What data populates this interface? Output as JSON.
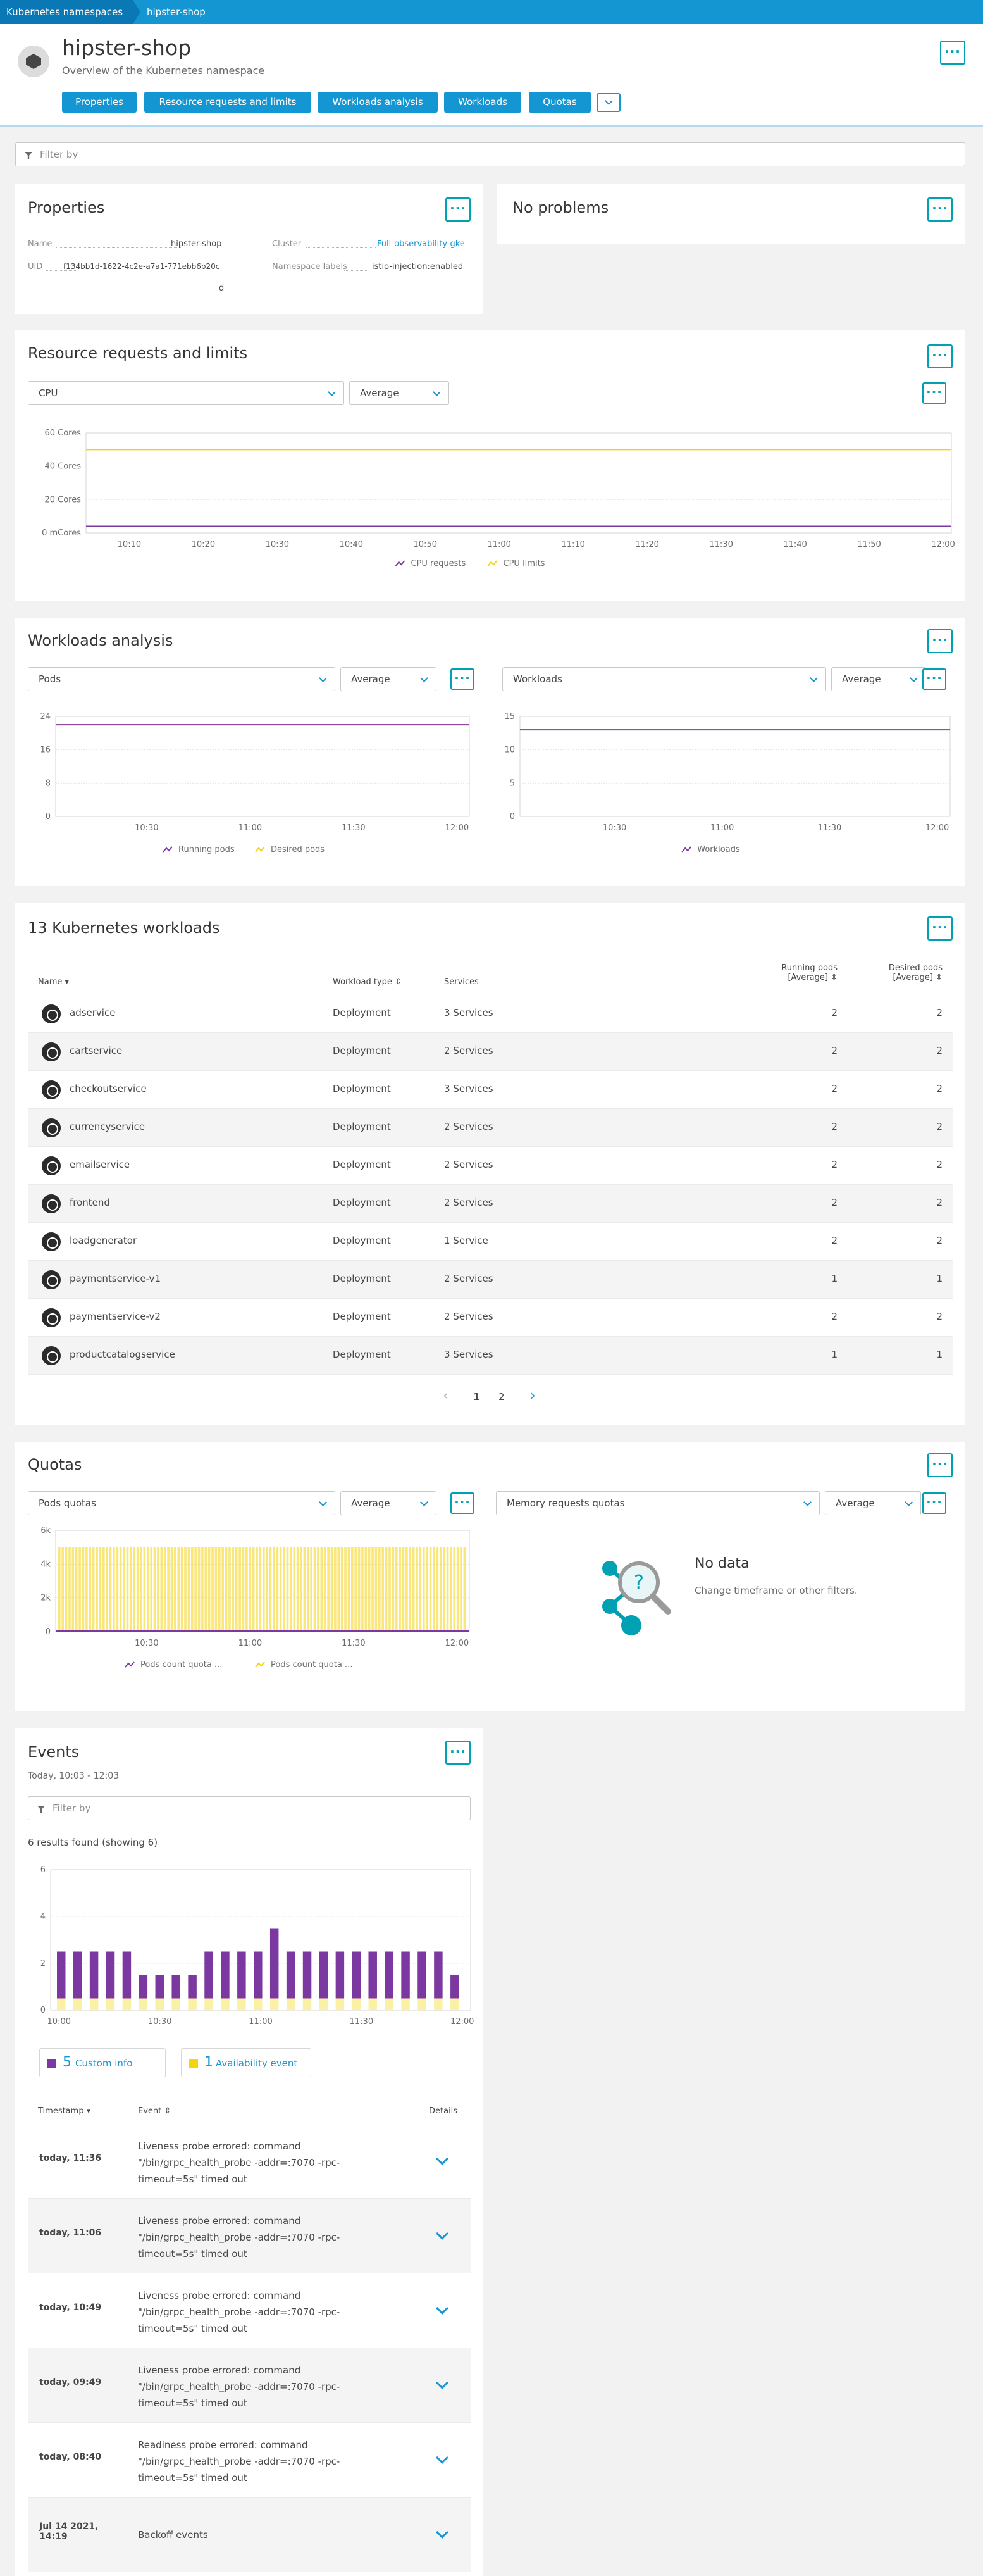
{
  "breadcrumb": {
    "root": "Kubernetes namespaces",
    "current": "hipster-shop"
  },
  "header": {
    "title": "hipster-shop",
    "subtitle": "Overview of the Kubernetes namespace"
  },
  "tabs": [
    "Properties",
    "Resource requests and limits",
    "Workloads analysis",
    "Workloads",
    "Quotas"
  ],
  "filter": {
    "placeholder": "Filter by"
  },
  "properties": {
    "title": "Properties",
    "name_label": "Name",
    "name_value": "hipster-shop",
    "uid_label": "UID",
    "uid_value": "f134bb1d-1622-4c2e-a7a1-771ebb6b20c",
    "uid_value_cont": "d",
    "cluster_label": "Cluster",
    "cluster_value": "Full-observability-gke",
    "ns_labels_label": "Namespace labels",
    "ns_labels_value": "istio-injection:enabled"
  },
  "problems": {
    "title": "No problems"
  },
  "resources": {
    "title": "Resource requests and limits",
    "metric_select": "CPU",
    "agg_select": "Average",
    "legend": [
      "CPU requests",
      "CPU limits"
    ]
  },
  "workloads_analysis": {
    "title": "Workloads analysis",
    "left_select": "Pods",
    "left_agg": "Average",
    "right_select": "Workloads",
    "right_agg": "Average",
    "left_legend": [
      "Running pods",
      "Desired pods"
    ],
    "right_legend": [
      "Workloads"
    ]
  },
  "workloads_table": {
    "title": "13 Kubernetes workloads",
    "headers": {
      "name": "Name",
      "type": "Workload type",
      "services": "Services",
      "running": "Running pods",
      "running2": "[Average]",
      "desired": "Desired pods",
      "desired2": "[Average]"
    },
    "rows": [
      {
        "name": "adservice",
        "type": "Deployment",
        "services": "3 Services",
        "running": "2",
        "desired": "2"
      },
      {
        "name": "cartservice",
        "type": "Deployment",
        "services": "2 Services",
        "running": "2",
        "desired": "2"
      },
      {
        "name": "checkoutservice",
        "type": "Deployment",
        "services": "3 Services",
        "running": "2",
        "desired": "2"
      },
      {
        "name": "currencyservice",
        "type": "Deployment",
        "services": "2 Services",
        "running": "2",
        "desired": "2"
      },
      {
        "name": "emailservice",
        "type": "Deployment",
        "services": "2 Services",
        "running": "2",
        "desired": "2"
      },
      {
        "name": "frontend",
        "type": "Deployment",
        "services": "2 Services",
        "running": "2",
        "desired": "2"
      },
      {
        "name": "loadgenerator",
        "type": "Deployment",
        "services": "1 Service",
        "running": "2",
        "desired": "2"
      },
      {
        "name": "paymentservice-v1",
        "type": "Deployment",
        "services": "2 Services",
        "running": "1",
        "desired": "1"
      },
      {
        "name": "paymentservice-v2",
        "type": "Deployment",
        "services": "2 Services",
        "running": "2",
        "desired": "2"
      },
      {
        "name": "productcatalogservice",
        "type": "Deployment",
        "services": "3 Services",
        "running": "1",
        "desired": "1"
      }
    ],
    "pages": [
      "1",
      "2"
    ]
  },
  "quotas": {
    "title": "Quotas",
    "left_select": "Pods quotas",
    "left_agg": "Average",
    "right_select": "Memory requests quotas",
    "right_agg": "Average",
    "left_legend": [
      "Pods count quota ...",
      "Pods count quota ..."
    ],
    "nodata_title": "No data",
    "nodata_text": "Change timeframe or other filters."
  },
  "events": {
    "title": "Events",
    "timeframe": "Today, 10:03 - 12:03",
    "filter_placeholder": "Filter by",
    "results": "6 results found (showing 6)",
    "custom_count": "5",
    "custom_label": "Custom info",
    "avail_count": "1",
    "avail_label": "Availability event",
    "headers": {
      "timestamp": "Timestamp",
      "event": "Event",
      "details": "Details"
    },
    "rows": [
      {
        "time": "today, 11:36",
        "l1": "Liveness probe errored: command",
        "l2": "\"/bin/grpc_health_probe -addr=:7070 -rpc-",
        "l3": "timeout=5s\" timed out"
      },
      {
        "time": "today, 11:06",
        "l1": "Liveness probe errored: command",
        "l2": "\"/bin/grpc_health_probe -addr=:7070 -rpc-",
        "l3": "timeout=5s\" timed out"
      },
      {
        "time": "today, 10:49",
        "l1": "Liveness probe errored: command",
        "l2": "\"/bin/grpc_health_probe -addr=:7070 -rpc-",
        "l3": "timeout=5s\" timed out"
      },
      {
        "time": "today, 09:49",
        "l1": "Liveness probe errored: command",
        "l2": "\"/bin/grpc_health_probe -addr=:7070 -rpc-",
        "l3": "timeout=5s\" timed out"
      },
      {
        "time": "today, 08:40",
        "l1": "Readiness probe errored: command",
        "l2": "\"/bin/grpc_health_probe -addr=:7070 -rpc-",
        "l3": "timeout=5s\" timed out"
      },
      {
        "time": "Jul 14 2021,",
        "time2": "14:19",
        "l1": "Backoff events",
        "l2": "",
        "l3": ""
      }
    ]
  },
  "colors": {
    "accent": "#1496d2",
    "purple": "#7c38a1",
    "yellow": "#f5d30f",
    "menu_teal": "#00a1b2"
  },
  "chart_data": [
    {
      "type": "line",
      "title": "Resource requests and limits",
      "x": [
        "10:10",
        "10:20",
        "10:30",
        "10:40",
        "10:50",
        "11:00",
        "11:10",
        "11:20",
        "11:30",
        "11:40",
        "11:50",
        "12:00"
      ],
      "yticks": [
        "0 mCores",
        "20 Cores",
        "40 Cores",
        "60 Cores"
      ],
      "ylim": [
        0,
        60
      ],
      "series": [
        {
          "name": "CPU requests",
          "value": 4,
          "color": "#7c38a1"
        },
        {
          "name": "CPU limits",
          "value": 50,
          "color": "#f5d30f"
        }
      ]
    },
    {
      "type": "line",
      "title": "Pods",
      "x": [
        "10:30",
        "11:00",
        "11:30",
        "12:00"
      ],
      "yticks": [
        "0",
        "8",
        "16",
        "24"
      ],
      "ylim": [
        0,
        24
      ],
      "series": [
        {
          "name": "Running pods",
          "value": 22,
          "color": "#7c38a1"
        },
        {
          "name": "Desired pods",
          "value": 22,
          "color": "#f5d30f"
        }
      ]
    },
    {
      "type": "line",
      "title": "Workloads",
      "x": [
        "10:30",
        "11:00",
        "11:30",
        "12:00"
      ],
      "yticks": [
        "0",
        "5",
        "10",
        "15"
      ],
      "ylim": [
        0,
        15
      ],
      "series": [
        {
          "name": "Workloads",
          "value": 13,
          "color": "#7c38a1"
        }
      ]
    },
    {
      "type": "bar",
      "title": "Pods quotas",
      "x": [
        "10:30",
        "11:00",
        "11:30",
        "12:00"
      ],
      "yticks": [
        "0",
        "2k",
        "4k",
        "6k"
      ],
      "ylim": [
        0,
        6000
      ],
      "series": [
        {
          "name": "Pods count quota ...",
          "value": 0,
          "color": "#7c38a1"
        },
        {
          "name": "Pods count quota ...",
          "value": 5000,
          "color": "#f5d30f"
        }
      ]
    },
    {
      "type": "bar",
      "title": "Events",
      "x": [
        "10:00",
        "10:30",
        "11:00",
        "11:30",
        "12:00"
      ],
      "yticks": [
        "0",
        "2",
        "4",
        "6"
      ],
      "ylim": [
        0,
        6
      ],
      "series": [
        {
          "name": "Custom info",
          "color": "#7c38a1",
          "values": [
            2,
            2,
            2,
            2,
            2,
            1,
            1,
            1,
            1,
            2,
            2,
            2,
            2,
            3,
            2,
            2,
            2,
            2,
            2,
            2,
            2,
            2,
            2,
            2,
            1
          ]
        },
        {
          "name": "Availability event",
          "color": "#f5d30f",
          "values": [
            1,
            1,
            1,
            1,
            1,
            1,
            1,
            1,
            1,
            1,
            1,
            1,
            1,
            1,
            1,
            1,
            1,
            1,
            1,
            1,
            1,
            1,
            1,
            1,
            1
          ]
        }
      ]
    }
  ]
}
